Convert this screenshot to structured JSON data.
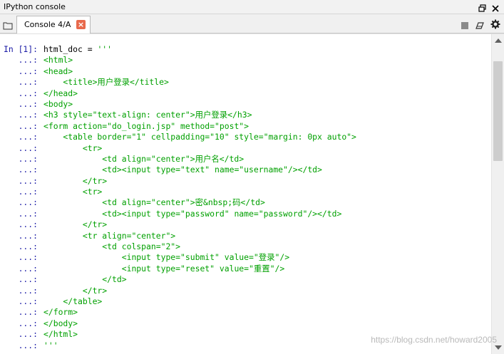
{
  "window": {
    "title": "IPython console",
    "icons": [
      "restore-icon",
      "close-icon"
    ]
  },
  "tabbar": {
    "browse_icon": "folder-icon",
    "tab_label": "Console 4/A",
    "tab_close": "×",
    "tools": [
      "stop-icon",
      "eraser-icon",
      "gear-icon"
    ]
  },
  "console": {
    "lines": [
      {
        "prompt": "In [1]: ",
        "parts": [
          {
            "t": "html_doc = ",
            "c": "plain"
          },
          {
            "t": "'''",
            "c": "str"
          }
        ]
      },
      {
        "prompt": "   ...: ",
        "parts": [
          {
            "t": "<html>",
            "c": "str"
          }
        ]
      },
      {
        "prompt": "   ...: ",
        "parts": [
          {
            "t": "<head>",
            "c": "str"
          }
        ]
      },
      {
        "prompt": "   ...: ",
        "parts": [
          {
            "t": "    <title>用户登录</title>",
            "c": "str"
          }
        ]
      },
      {
        "prompt": "   ...: ",
        "parts": [
          {
            "t": "</head>",
            "c": "str"
          }
        ]
      },
      {
        "prompt": "   ...: ",
        "parts": [
          {
            "t": "<body>",
            "c": "str"
          }
        ]
      },
      {
        "prompt": "   ...: ",
        "parts": [
          {
            "t": "<h3 style=\"text-align: center\">用户登录</h3>",
            "c": "str"
          }
        ]
      },
      {
        "prompt": "   ...: ",
        "parts": [
          {
            "t": "<form action=\"do_login.jsp\" method=\"post\">",
            "c": "str"
          }
        ]
      },
      {
        "prompt": "   ...: ",
        "parts": [
          {
            "t": "    <table border=\"1\" cellpadding=\"10\" style=\"margin: 0px auto\">",
            "c": "str"
          }
        ]
      },
      {
        "prompt": "   ...: ",
        "parts": [
          {
            "t": "        <tr>",
            "c": "str"
          }
        ]
      },
      {
        "prompt": "   ...: ",
        "parts": [
          {
            "t": "            <td align=\"center\">用户名</td>",
            "c": "str"
          }
        ]
      },
      {
        "prompt": "   ...: ",
        "parts": [
          {
            "t": "            <td><input type=\"text\" name=\"username\"/></td>",
            "c": "str"
          }
        ]
      },
      {
        "prompt": "   ...: ",
        "parts": [
          {
            "t": "        </tr>",
            "c": "str"
          }
        ]
      },
      {
        "prompt": "   ...: ",
        "parts": [
          {
            "t": "        <tr>",
            "c": "str"
          }
        ]
      },
      {
        "prompt": "   ...: ",
        "parts": [
          {
            "t": "            <td align=\"center\">密&nbsp;码</td>",
            "c": "str"
          }
        ]
      },
      {
        "prompt": "   ...: ",
        "parts": [
          {
            "t": "            <td><input type=\"password\" name=\"password\"/></td>",
            "c": "str"
          }
        ]
      },
      {
        "prompt": "   ...: ",
        "parts": [
          {
            "t": "        </tr>",
            "c": "str"
          }
        ]
      },
      {
        "prompt": "   ...: ",
        "parts": [
          {
            "t": "        <tr align=\"center\">",
            "c": "str"
          }
        ]
      },
      {
        "prompt": "   ...: ",
        "parts": [
          {
            "t": "            <td colspan=\"2\">",
            "c": "str"
          }
        ]
      },
      {
        "prompt": "   ...: ",
        "parts": [
          {
            "t": "                <input type=\"submit\" value=\"登录\"/>",
            "c": "str"
          }
        ]
      },
      {
        "prompt": "   ...: ",
        "parts": [
          {
            "t": "                <input type=\"reset\" value=\"重置\"/>",
            "c": "str"
          }
        ]
      },
      {
        "prompt": "   ...: ",
        "parts": [
          {
            "t": "            </td>",
            "c": "str"
          }
        ]
      },
      {
        "prompt": "   ...: ",
        "parts": [
          {
            "t": "        </tr>",
            "c": "str"
          }
        ]
      },
      {
        "prompt": "   ...: ",
        "parts": [
          {
            "t": "    </table>",
            "c": "str"
          }
        ]
      },
      {
        "prompt": "   ...: ",
        "parts": [
          {
            "t": "</form>",
            "c": "str"
          }
        ]
      },
      {
        "prompt": "   ...: ",
        "parts": [
          {
            "t": "</body>",
            "c": "str"
          }
        ]
      },
      {
        "prompt": "   ...: ",
        "parts": [
          {
            "t": "</html>",
            "c": "str"
          }
        ]
      },
      {
        "prompt": "   ...: ",
        "parts": [
          {
            "t": "'''",
            "c": "str"
          }
        ]
      }
    ]
  },
  "watermark": "https://blog.csdn.net/howard2005",
  "colors": {
    "prompt": "#1a1aa6",
    "string": "#00a000",
    "code": "#000000",
    "tab_close": "#e8694c"
  }
}
